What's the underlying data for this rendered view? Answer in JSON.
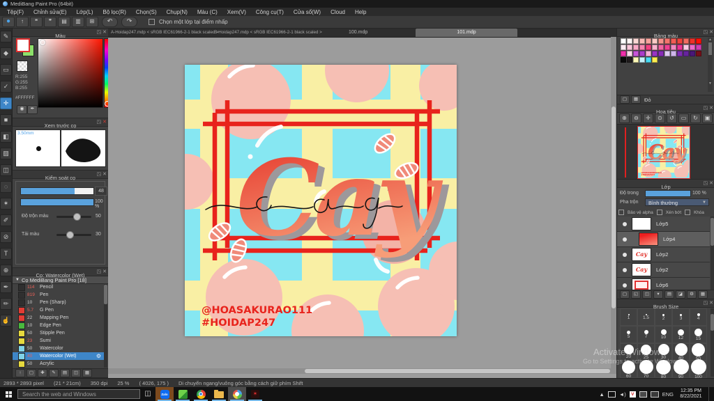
{
  "window": {
    "title": "MediBang Paint Pro (64bit)"
  },
  "menubar": {
    "items": [
      "Tệp(F)",
      "Chỉnh sửa(E)",
      "Lớp(L)",
      "Bộ lọc(R)",
      "Chọn(S)",
      "Chụp(N)",
      "Màu (C)",
      "Xem(V)",
      "Công cụ(T)",
      "Cửa sổ(W)",
      "Cloud",
      "Help"
    ]
  },
  "toolbar": {
    "buttons": [
      {
        "name": "main-menu-button",
        "glyph": "●"
      },
      {
        "name": "save-button",
        "glyph": "↑"
      },
      {
        "name": "comment-button",
        "glyph": "❝"
      },
      {
        "name": "chat-button",
        "glyph": "❞"
      },
      {
        "name": "post-button",
        "glyph": "▤"
      },
      {
        "name": "material-button",
        "glyph": "▥"
      },
      {
        "name": "split-window-button",
        "glyph": "⊞"
      }
    ],
    "undo_glyph": "↶",
    "redo_glyph": "↷",
    "checkbox_label": "Chọn một lớp tại điểm nhấp"
  },
  "tabs": [
    {
      "label": "A-Hoidap247.mdp < sRGB IEC61966-2-1 black scaled >"
    },
    {
      "label": "B-Hoidap247.mdp < sRGB IEC61966-2-1 black scaled >"
    },
    {
      "label": "100.mdp"
    },
    {
      "label": "101.mdp"
    }
  ],
  "tools": [
    {
      "name": "pen-tool",
      "glyph": "✎"
    },
    {
      "name": "eraser-tool",
      "glyph": "◆"
    },
    {
      "name": "shape-brush-tool",
      "glyph": "▭"
    },
    {
      "name": "select-pen-check-tool",
      "glyph": "✓"
    },
    {
      "name": "move-tool",
      "glyph": "✛",
      "active": true
    },
    {
      "name": "fill-rect-tool",
      "glyph": "■"
    },
    {
      "name": "bucket-tool",
      "glyph": "◧"
    },
    {
      "name": "gradient-tool",
      "glyph": "▨"
    },
    {
      "name": "marquee-select-tool",
      "glyph": "◫"
    },
    {
      "name": "lasso-tool",
      "glyph": "◌"
    },
    {
      "name": "magic-wand-tool",
      "glyph": "✶"
    },
    {
      "name": "select-pen-tool",
      "glyph": "✐"
    },
    {
      "name": "select-eraser-tool",
      "glyph": "⊘"
    },
    {
      "name": "text-tool",
      "glyph": "T"
    },
    {
      "name": "zoom-tool",
      "glyph": "⊕"
    },
    {
      "name": "eyedropper-tool",
      "glyph": "✒"
    },
    {
      "name": "divide-tool",
      "glyph": "✏"
    },
    {
      "name": "hand-tool",
      "glyph": "☝"
    }
  ],
  "color_panel": {
    "title": "Màu",
    "r": "R:255",
    "g": "G:255",
    "b": "B:255",
    "hex": "#FFFFFF",
    "fg_color": "#ffffff",
    "bg_color": "#8ce06a"
  },
  "brush_preview": {
    "title": "Xem trước cọ",
    "size_label": "3.50mm"
  },
  "brush_control": {
    "title": "Kiểm soát cọ",
    "size_value": "48",
    "opacity_value": "100 %",
    "mix_label": "Độ trộn màu",
    "mix_value": "50",
    "load_label": "Tải màu",
    "load_value": "30"
  },
  "brush_list": {
    "title": "Cọ: Watercolor (Wet)",
    "group_label": "Cọ MediBang Paint Pro [18]",
    "items": [
      {
        "num": "114",
        "name": "Pencil",
        "swatch": "#2f2f2f",
        "hot": true
      },
      {
        "num": "819",
        "name": "Pen",
        "swatch": "#2f2f2f",
        "hot": true
      },
      {
        "num": "10",
        "name": "Pen (Sharp)",
        "swatch": "#2f2f2f",
        "hot": false
      },
      {
        "num": "5.7",
        "name": "G Pen",
        "swatch": "#e23c34",
        "hot": true
      },
      {
        "num": "22",
        "name": "Mapping Pen",
        "swatch": "#e23c34",
        "hot": false
      },
      {
        "num": "10",
        "name": "Edge Pen",
        "swatch": "#49b83e",
        "hot": false
      },
      {
        "num": "50",
        "name": "Stipple Pen",
        "swatch": "#e6d93e",
        "hot": false
      },
      {
        "num": "23",
        "name": "Sumi",
        "swatch": "#e6d93e",
        "hot": true
      },
      {
        "num": "50",
        "name": "Watercolor",
        "swatch": "#7fd2e8",
        "hot": false
      },
      {
        "num": "40",
        "name": "Watercolor (Wet)",
        "swatch": "#7fd2e8",
        "hot": true,
        "selected": true
      },
      {
        "num": "50",
        "name": "Acrylic",
        "swatch": "#e6d93e",
        "hot": false
      }
    ]
  },
  "palette_panel": {
    "title": "Bảng màu",
    "selected_name": "Đỏ",
    "rows": [
      [
        "#ffffff",
        "#fdf4f3",
        "#fad7d4",
        "#f8bab6",
        "#f7a39d",
        "#fbcbc6",
        "#f5928b",
        "#f4746d",
        "#f15c55",
        "#ef443e",
        "#f16c62",
        "#ed312a",
        "#fb1008"
      ],
      [
        "#fdebf2",
        "#fbc6da",
        "#f9a8c6",
        "#f684af",
        "#f34181",
        "#f9b4ce",
        "#f264a1",
        "#ef4091",
        "#f189c1",
        "#ed3294",
        "#f9c7e4",
        "#ec69ca",
        "#d23db4"
      ],
      [
        "#ef2eaa",
        "#fbd9ea",
        "#c755d8",
        "#a93dca",
        "#f7b0d8",
        "#9935c3",
        "#862bb6",
        "#ddcaf1",
        "#cfb6eb",
        "#7c2db2",
        "#66249e",
        "#491879",
        "#770f19"
      ],
      [
        "#0a0a0a",
        "#201c1d",
        "#fdf8b7",
        "#c5f1f9",
        "#47daf2",
        "#fded50"
      ]
    ]
  },
  "navigator": {
    "title": "Hoa tiêu",
    "buttons": [
      {
        "name": "zoom-in-button",
        "glyph": "⊕"
      },
      {
        "name": "zoom-out-button",
        "glyph": "⊖"
      },
      {
        "name": "fit-screen-button",
        "glyph": "✛"
      },
      {
        "name": "actual-size-button",
        "glyph": "⊙"
      },
      {
        "name": "rotate-left-button",
        "glyph": "↺"
      },
      {
        "name": "reset-rotation-button",
        "glyph": "▭"
      },
      {
        "name": "rotate-right-button",
        "glyph": "↻"
      },
      {
        "name": "lock-button",
        "glyph": "▣"
      }
    ]
  },
  "layers_panel": {
    "title": "Lớp",
    "opacity_label": "Độ trong",
    "opacity_value": "100 %",
    "blend_label": "Pha trộn",
    "blend_value": "Bình thường",
    "checkboxes": [
      "Bảo vệ alpha",
      "Xén bớt",
      "Khóa"
    ],
    "items": [
      {
        "name": "Lớp5",
        "thumb": "checker"
      },
      {
        "name": "Lớp4",
        "thumb": "gradient",
        "selected": true,
        "clipped": true
      },
      {
        "name": "Lớp2",
        "thumb": "cay"
      },
      {
        "name": "Lớp2",
        "thumb": "cay"
      },
      {
        "name": "Lớp6",
        "thumb": "frame"
      }
    ]
  },
  "brush_size_panel": {
    "title": "Brush Size",
    "items": [
      {
        "label": "1",
        "dot": 2
      },
      {
        "label": "1.5",
        "dot": 2
      },
      {
        "label": "2",
        "dot": 3
      },
      {
        "label": "3",
        "dot": 3
      },
      {
        "label": "4",
        "dot": 4
      },
      {
        "label": "5",
        "dot": 5
      },
      {
        "label": "7",
        "dot": 6
      },
      {
        "label": "10",
        "dot": 8
      },
      {
        "label": "12",
        "dot": 9
      },
      {
        "label": "15",
        "dot": 11
      },
      {
        "label": "20",
        "dot": 14
      },
      {
        "label": "25",
        "dot": 15
      },
      {
        "label": "30",
        "dot": 16
      },
      {
        "label": "40",
        "dot": 18
      },
      {
        "label": "50",
        "dot": 19
      },
      {
        "label": "60",
        "dot": 19
      },
      {
        "label": "70",
        "dot": 20
      },
      {
        "label": "80",
        "dot": 21
      },
      {
        "label": "90",
        "dot": 22
      },
      {
        "label": "100",
        "dot": 22
      }
    ]
  },
  "canvas": {
    "word": "Cay",
    "cursive_word": "cay",
    "handle": "@HOASAKURAO111",
    "hashtag": "#HOIDAP247",
    "bg_color": "#86e7f2",
    "stripe_color": "#f9efa4",
    "bubble_color": "#f6bfb4",
    "frame_color": "#e8231c",
    "word_gradient": [
      "#e5352a",
      "#f79d78"
    ]
  },
  "statusbar": {
    "segments": [
      "2893 * 2893 pixel",
      "(21 * 21cm)",
      "350 dpi",
      "25 %",
      "( 4026, 175 )",
      "Di chuyển ngang/vuông góc bằng cách giữ phím Shift"
    ]
  },
  "watermark": {
    "line1": "Activate Windows",
    "line2": "Go to Settings to activate Windows"
  },
  "taskbar": {
    "search_placeholder": "Search the web and Windows",
    "zalo_label": "Zalo",
    "lang": "ENG",
    "time": "12:35 PM",
    "date": "8/22/2021"
  }
}
